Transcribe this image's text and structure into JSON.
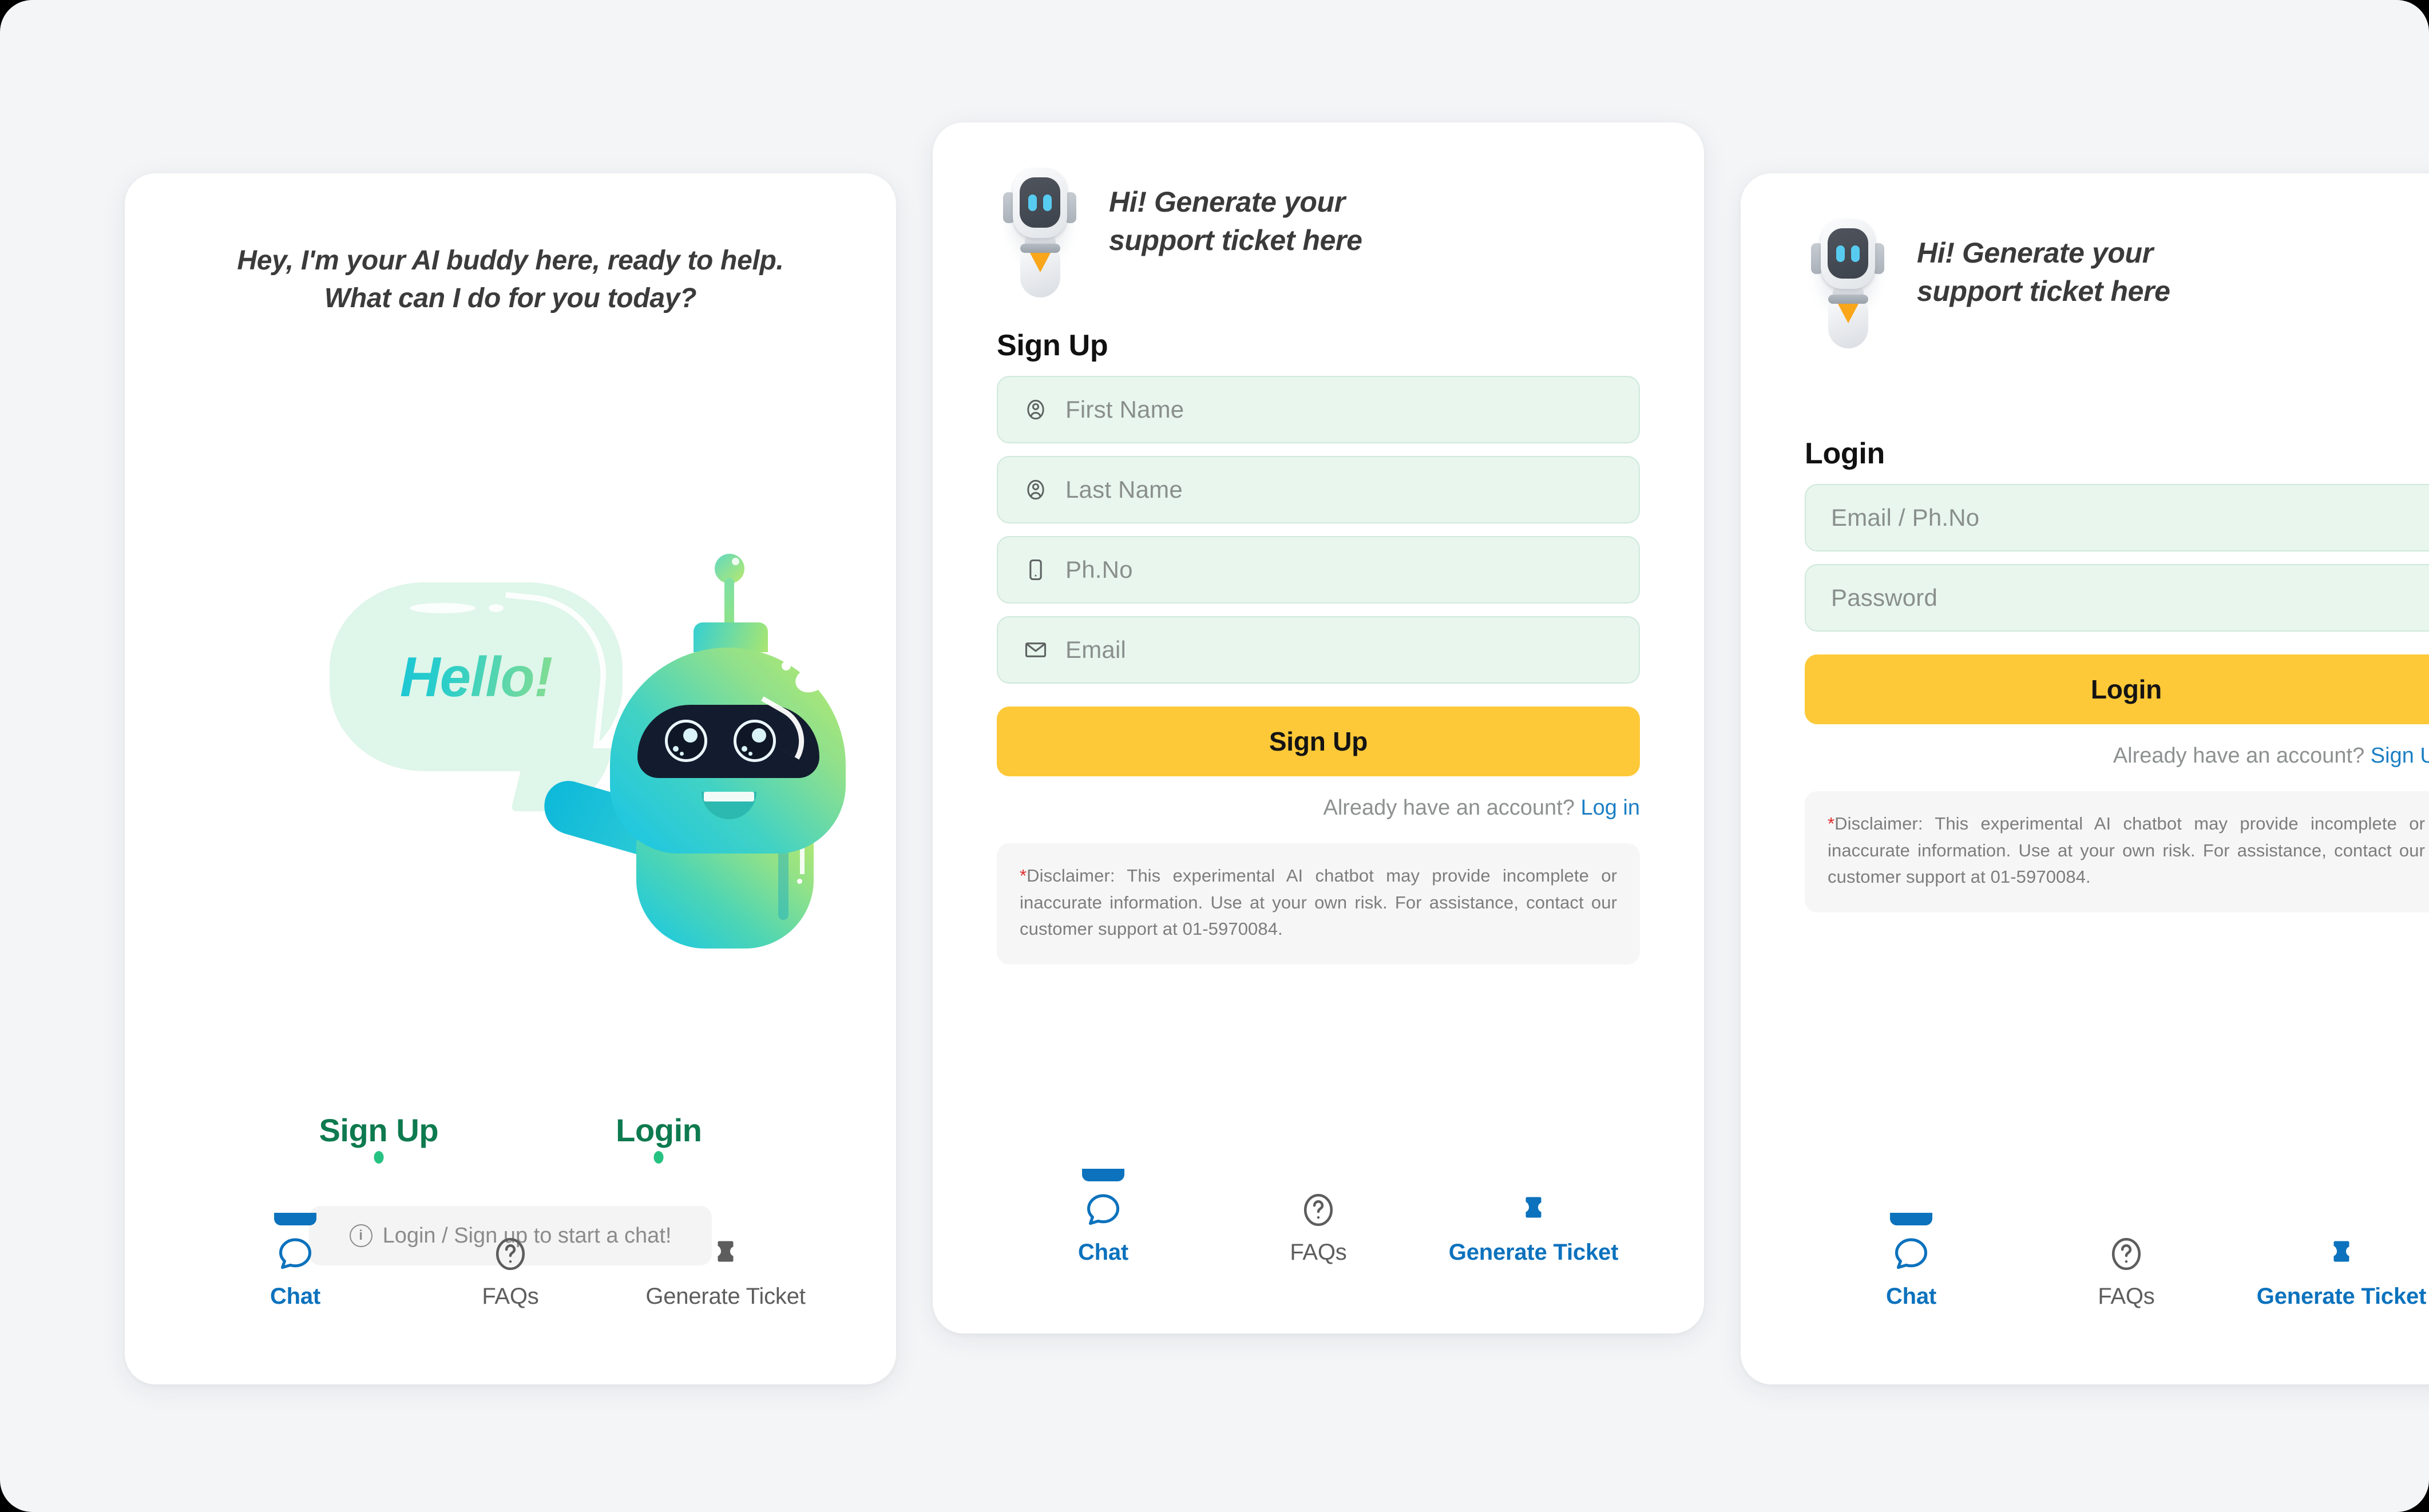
{
  "theme": {
    "page_bg": "#f4f5f7",
    "card_bg": "#ffffff",
    "accent_yellow": "#fdc938",
    "accent_blue": "#0c72bd",
    "accent_green": "#0d7a4f",
    "field_bg": "#e8f6ee",
    "field_border": "#cfe9dc",
    "disclaimer_star": "#e12d2d"
  },
  "chat_card": {
    "intro_line_1": "Hey, I'm your AI buddy here, ready to help.",
    "intro_line_2": "What can I do for you today?",
    "bubble_text": "Hello!",
    "signup_link": "Sign Up",
    "login_link": "Login",
    "hint": "Login / Sign up to start a chat!",
    "hint_icon": "info-circle-icon",
    "mascot_icon": "green-robot-mascot"
  },
  "signup_card": {
    "header_title_line_1": "Hi! Generate your",
    "header_title_line_2": "support ticket here",
    "header_avatar_icon": "grey-robot-avatar-icon",
    "form_title": "Sign Up",
    "fields": [
      {
        "placeholder": "First Name",
        "icon": "user-circle-icon",
        "value": ""
      },
      {
        "placeholder": "Last Name",
        "icon": "user-circle-icon",
        "value": ""
      },
      {
        "placeholder": "Ph.No",
        "icon": "phone-icon",
        "value": ""
      },
      {
        "placeholder": "Email",
        "icon": "envelope-icon",
        "value": ""
      }
    ],
    "submit_label": "Sign Up",
    "switch_prompt": "Already have an account? ",
    "switch_link": "Log in",
    "disclaimer_star": "*",
    "disclaimer": "Disclaimer: This experimental AI chatbot may provide incomplete or inaccurate information. Use at your own risk. For assistance, contact our customer support at 01-5970084."
  },
  "login_card": {
    "header_title_line_1": "Hi! Generate your",
    "header_title_line_2": "support ticket here",
    "header_avatar_icon": "grey-robot-avatar-icon",
    "form_title": "Login",
    "fields": [
      {
        "placeholder": "Email / Ph.No",
        "icon": "",
        "value": ""
      },
      {
        "placeholder": "Password",
        "icon": "",
        "value": ""
      }
    ],
    "submit_label": "Login",
    "switch_prompt": "Already have an account? ",
    "switch_link": "Sign Up",
    "disclaimer_star": "*",
    "disclaimer": "Disclaimer: This experimental AI chatbot may provide incomplete or inaccurate information. Use at your own risk. For assistance, contact our customer support at 01-5970084."
  },
  "bottom_nav": {
    "chat": {
      "label": "Chat",
      "icon": "chat-bubble-icon"
    },
    "faqs": {
      "label": "FAQs",
      "icon": "question-circle-icon"
    },
    "ticket": {
      "label": "Generate Ticket",
      "icon": "ticket-icon"
    }
  }
}
